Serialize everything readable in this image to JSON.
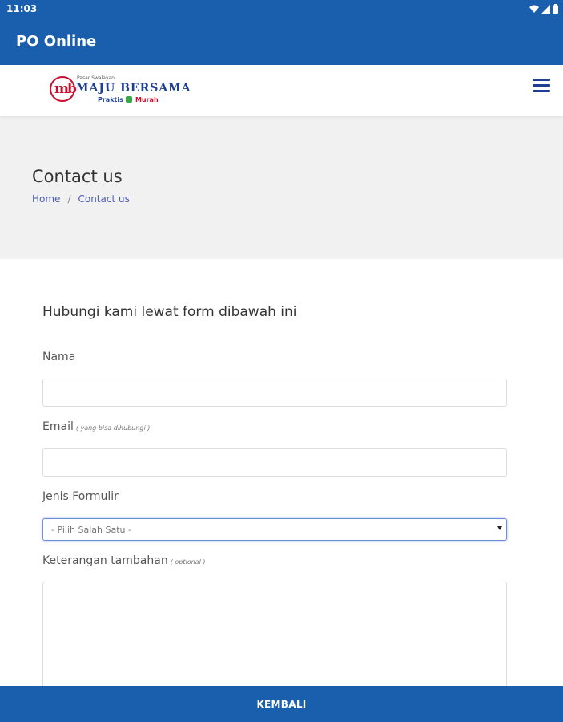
{
  "status_bar": {
    "time": "11:03",
    "icons": [
      "wifi-icon",
      "signal-icon",
      "battery-icon"
    ]
  },
  "app_bar": {
    "title": "PO Online"
  },
  "site_header": {
    "logo": {
      "badge": "mb",
      "small_text": "Pasar Swalayan",
      "main_text": "MAJU BERSAMA",
      "tagline_1": "Praktis",
      "tagline_2": "Murah"
    },
    "menu_icon": "hamburger-menu-icon"
  },
  "hero": {
    "title": "Contact us",
    "breadcrumb": {
      "home": "Home",
      "separator": "/",
      "current": "Contact us"
    }
  },
  "form": {
    "heading": "Hubungi kami lewat form dibawah ini",
    "name_label": "Nama",
    "name_value": "",
    "email_label": "Email",
    "email_hint": "( yang bisa dihubungi )",
    "email_value": "",
    "type_label": "Jenis Formulir",
    "type_selected": "- Pilih Salah Satu -",
    "notes_label": "Keterangan tambahan",
    "notes_hint": "( optional )",
    "notes_value": ""
  },
  "bottom_bar": {
    "label": "KEMBALI"
  },
  "colors": {
    "primary": "#1a5fae",
    "hero_bg": "#f1f1f1",
    "brand_red": "#c8102e",
    "brand_blue": "#1f3f94"
  }
}
